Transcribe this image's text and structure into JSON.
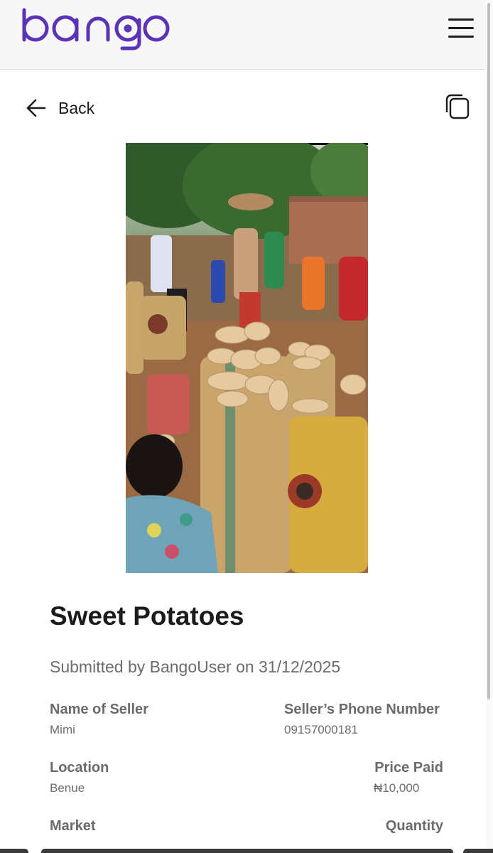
{
  "header": {
    "brand": "bango",
    "menu_icon": "hamburger-menu-icon"
  },
  "nav": {
    "back_label": "Back",
    "copy_icon": "copy-icon"
  },
  "product": {
    "title": "Sweet Potatoes",
    "submitted_text": "Submitted by BangoUser on 31/12/2025",
    "photo_subject": "Market scene with sacks of sweet potatoes"
  },
  "details": {
    "seller_name_label": "Name of Seller",
    "seller_name": "Mimi",
    "seller_phone_label": "Seller’s Phone Number",
    "seller_phone": "09157000181",
    "location_label": "Location",
    "location": "Benue",
    "price_label": "Price Paid",
    "price": "₦10,000",
    "market_label": "Market",
    "quantity_label": "Quantity"
  },
  "colors": {
    "brand": "#5b33b8",
    "text": "#1b1b1b",
    "muted": "#6b6b70"
  }
}
